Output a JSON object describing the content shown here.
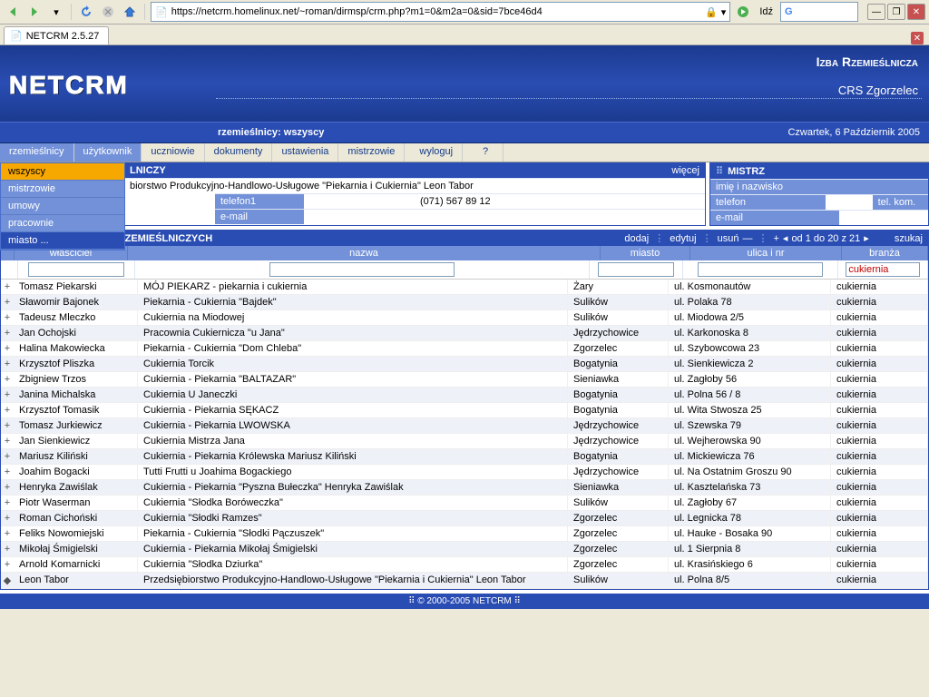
{
  "browser": {
    "url": "https://netcrm.homelinux.net/~roman/dirmsp/crm.php?m1=0&m2a=0&sid=7bce46d4",
    "go_label": "Idź",
    "tab_title": "NETCRM 2.5.27"
  },
  "banner": {
    "logo": "NETCRM",
    "org": "Izba Rzemieślnicza",
    "org_sub": "CRS Zgorzelec",
    "subtitle": "rzemieślnicy: wszyscy",
    "date": "Czwartek, 6 Październik 2005"
  },
  "menu": [
    "rzemieślnicy",
    "użytkownik",
    "uczniowie",
    "dokumenty",
    "ustawienia",
    "mistrzowie",
    "wyloguj"
  ],
  "menu_help": "?",
  "side_dd": [
    "wszyscy",
    "mistrzowie",
    "umowy",
    "pracownie",
    "miasto ..."
  ],
  "info_panel": {
    "title_suffix": "LNICZY",
    "more": "więcej",
    "company": "biorstwo Produkcyjno-Handlowo-Usługowe \"Piekarnia i Cukiernia\" Leon Tabor",
    "phone_lbl": "telefon1",
    "phone_val": "(071) 567 89 12",
    "email_lbl": "e-mail",
    "email_val": ""
  },
  "mistrz_panel": {
    "title": "MISTRZ",
    "name_lbl": "imię i nazwisko",
    "phone_lbl": "telefon",
    "mob_lbl": "tel. kom.",
    "email_lbl": "e-mail"
  },
  "list": {
    "title": "WYKAZ ZAKŁADÓW RZEMIEŚLNICZYCH",
    "tools": {
      "add": "dodaj",
      "edit": "edytuj",
      "del": "usuń",
      "range": "od 1 do 20 z 21",
      "search": "szukaj"
    },
    "cols": {
      "owner": "właściciel",
      "name": "nazwa",
      "city": "miasto",
      "street": "ulica i nr",
      "branch": "branża"
    },
    "filter_branch": "cukiernia",
    "rows": [
      {
        "o": "Tomasz Piekarski",
        "n": "MÓJ PIEKARZ - piekarnia i cukiernia",
        "c": "Żary",
        "s": "ul. Kosmonautów",
        "b": "cukiernia"
      },
      {
        "o": "Sławomir Bajonek",
        "n": "Piekarnia - Cukiernia \"Bajdek\"",
        "c": "Sulików",
        "s": "ul. Polaka 78",
        "b": "cukiernia"
      },
      {
        "o": "Tadeusz Mleczko",
        "n": "Cukiernia na Miodowej",
        "c": "Sulików",
        "s": "ul. Miodowa 2/5",
        "b": "cukiernia"
      },
      {
        "o": "Jan Ochojski",
        "n": "Pracownia Cukiernicza \"u Jana\"",
        "c": "Jędrzychowice",
        "s": "ul. Karkonoska 8",
        "b": "cukiernia"
      },
      {
        "o": "Halina Makowiecka",
        "n": "Piekarnia - Cukiernia \"Dom Chleba\"",
        "c": "Zgorzelec",
        "s": "ul. Szybowcowa 23",
        "b": "cukiernia"
      },
      {
        "o": "Krzysztof Pliszka",
        "n": "Cukiernia Torcik",
        "c": "Bogatynia",
        "s": "ul. Sienkiewicza 2",
        "b": "cukiernia"
      },
      {
        "o": "Zbigniew Trzos",
        "n": "Cukiernia - Piekarnia \"BALTAZAR\"",
        "c": "Sieniawka",
        "s": "ul. Zagłoby 56",
        "b": "cukiernia"
      },
      {
        "o": "Janina Michalska",
        "n": "Cukiernia U Janeczki",
        "c": "Bogatynia",
        "s": "ul. Polna 56 / 8",
        "b": "cukiernia"
      },
      {
        "o": "Krzysztof Tomasik",
        "n": "Cukiernia - Piekarnia SĘKACZ",
        "c": "Bogatynia",
        "s": "ul. Wita Stwosza 25",
        "b": "cukiernia"
      },
      {
        "o": "Tomasz Jurkiewicz",
        "n": "Cukiernia - Piekarnia LWOWSKA",
        "c": "Jędrzychowice",
        "s": "ul. Szewska 79",
        "b": "cukiernia"
      },
      {
        "o": "Jan Sienkiewicz",
        "n": "Cukiernia Mistrza Jana",
        "c": "Jędrzychowice",
        "s": "ul. Wejherowska 90",
        "b": "cukiernia"
      },
      {
        "o": "Mariusz Kiliński",
        "n": "Cukiernia - Piekarnia Królewska Mariusz Kiliński",
        "c": "Bogatynia",
        "s": "ul. Mickiewicza 76",
        "b": "cukiernia"
      },
      {
        "o": "Joahim Bogacki",
        "n": "Tutti Frutti u Joahima Bogackiego",
        "c": "Jędrzychowice",
        "s": "ul. Na Ostatnim Groszu 90",
        "b": "cukiernia"
      },
      {
        "o": "Henryka Zawiślak",
        "n": "Cukiernia - Piekarnia \"Pyszna Bułeczka\" Henryka Zawiślak",
        "c": "Sieniawka",
        "s": "ul. Kasztelańska 73",
        "b": "cukiernia"
      },
      {
        "o": "Piotr Waserman",
        "n": "Cukiernia \"Słodka Boróweczka\"",
        "c": "Sulików",
        "s": "ul. Zagłoby 67",
        "b": "cukiernia"
      },
      {
        "o": "Roman Cichoński",
        "n": "Cukiernia \"Słodki Ramzes\"",
        "c": "Zgorzelec",
        "s": "ul. Legnicka 78",
        "b": "cukiernia"
      },
      {
        "o": "Feliks Nowomiejski",
        "n": "Piekarnia - Cukiernia \"Słodki Pączuszek\"",
        "c": "Zgorzelec",
        "s": "ul. Hauke - Bosaka 90",
        "b": "cukiernia"
      },
      {
        "o": "Mikołaj Śmigielski",
        "n": "Cukiernia - Piekarnia Mikołaj Śmigielski",
        "c": "Zgorzelec",
        "s": "ul. 1 Sierpnia 8",
        "b": "cukiernia"
      },
      {
        "o": "Arnold Komarnicki",
        "n": "Cukiernia \"Słodka Dziurka\"",
        "c": "Zgorzelec",
        "s": "ul. Krasińskiego 6",
        "b": "cukiernia"
      },
      {
        "o": "Leon Tabor",
        "n": "Przedsiębiorstwo Produkcyjno-Handlowo-Usługowe \"Piekarnia i Cukiernia\" Leon Tabor",
        "c": "Sulików",
        "s": "ul. Polna 8/5",
        "b": "cukiernia"
      }
    ]
  },
  "footer": "© 2000-2005 NETCRM"
}
